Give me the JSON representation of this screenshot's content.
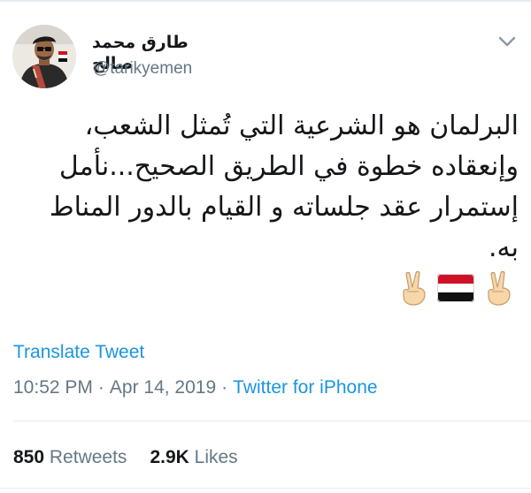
{
  "author": {
    "display_name": "طارق محمد صالح",
    "handle": "@tarikyemen",
    "avatar_icon": "profile-photo"
  },
  "tweet": {
    "text": "البرلمان هو الشرعية التي تُمثل الشعب، وإنعقاده خطوة في الطريق الصحيح...نأمل إستمرار عقد جلساته و القيام بالدور المناط به.",
    "emojis": [
      "victory-hand-icon",
      "yemen-flag-icon",
      "victory-hand-icon"
    ]
  },
  "actions": {
    "translate_label": "Translate Tweet",
    "caret_icon": "chevron-down-icon"
  },
  "meta": {
    "time": "10:52 PM",
    "separator": "·",
    "date": "Apr 14, 2019",
    "source": "Twitter for iPhone"
  },
  "stats": {
    "retweets_count": "850",
    "retweets_label": "Retweets",
    "likes_count": "2.9K",
    "likes_label": "Likes"
  },
  "colors": {
    "link": "#1b95e0",
    "secondary_text": "#657786",
    "primary_text": "#14171a",
    "divider": "#e6ecf0",
    "flag_red": "#ce1126",
    "flag_white": "#ffffff",
    "flag_black": "#000000",
    "skin_tone": "#f7d7a8"
  }
}
